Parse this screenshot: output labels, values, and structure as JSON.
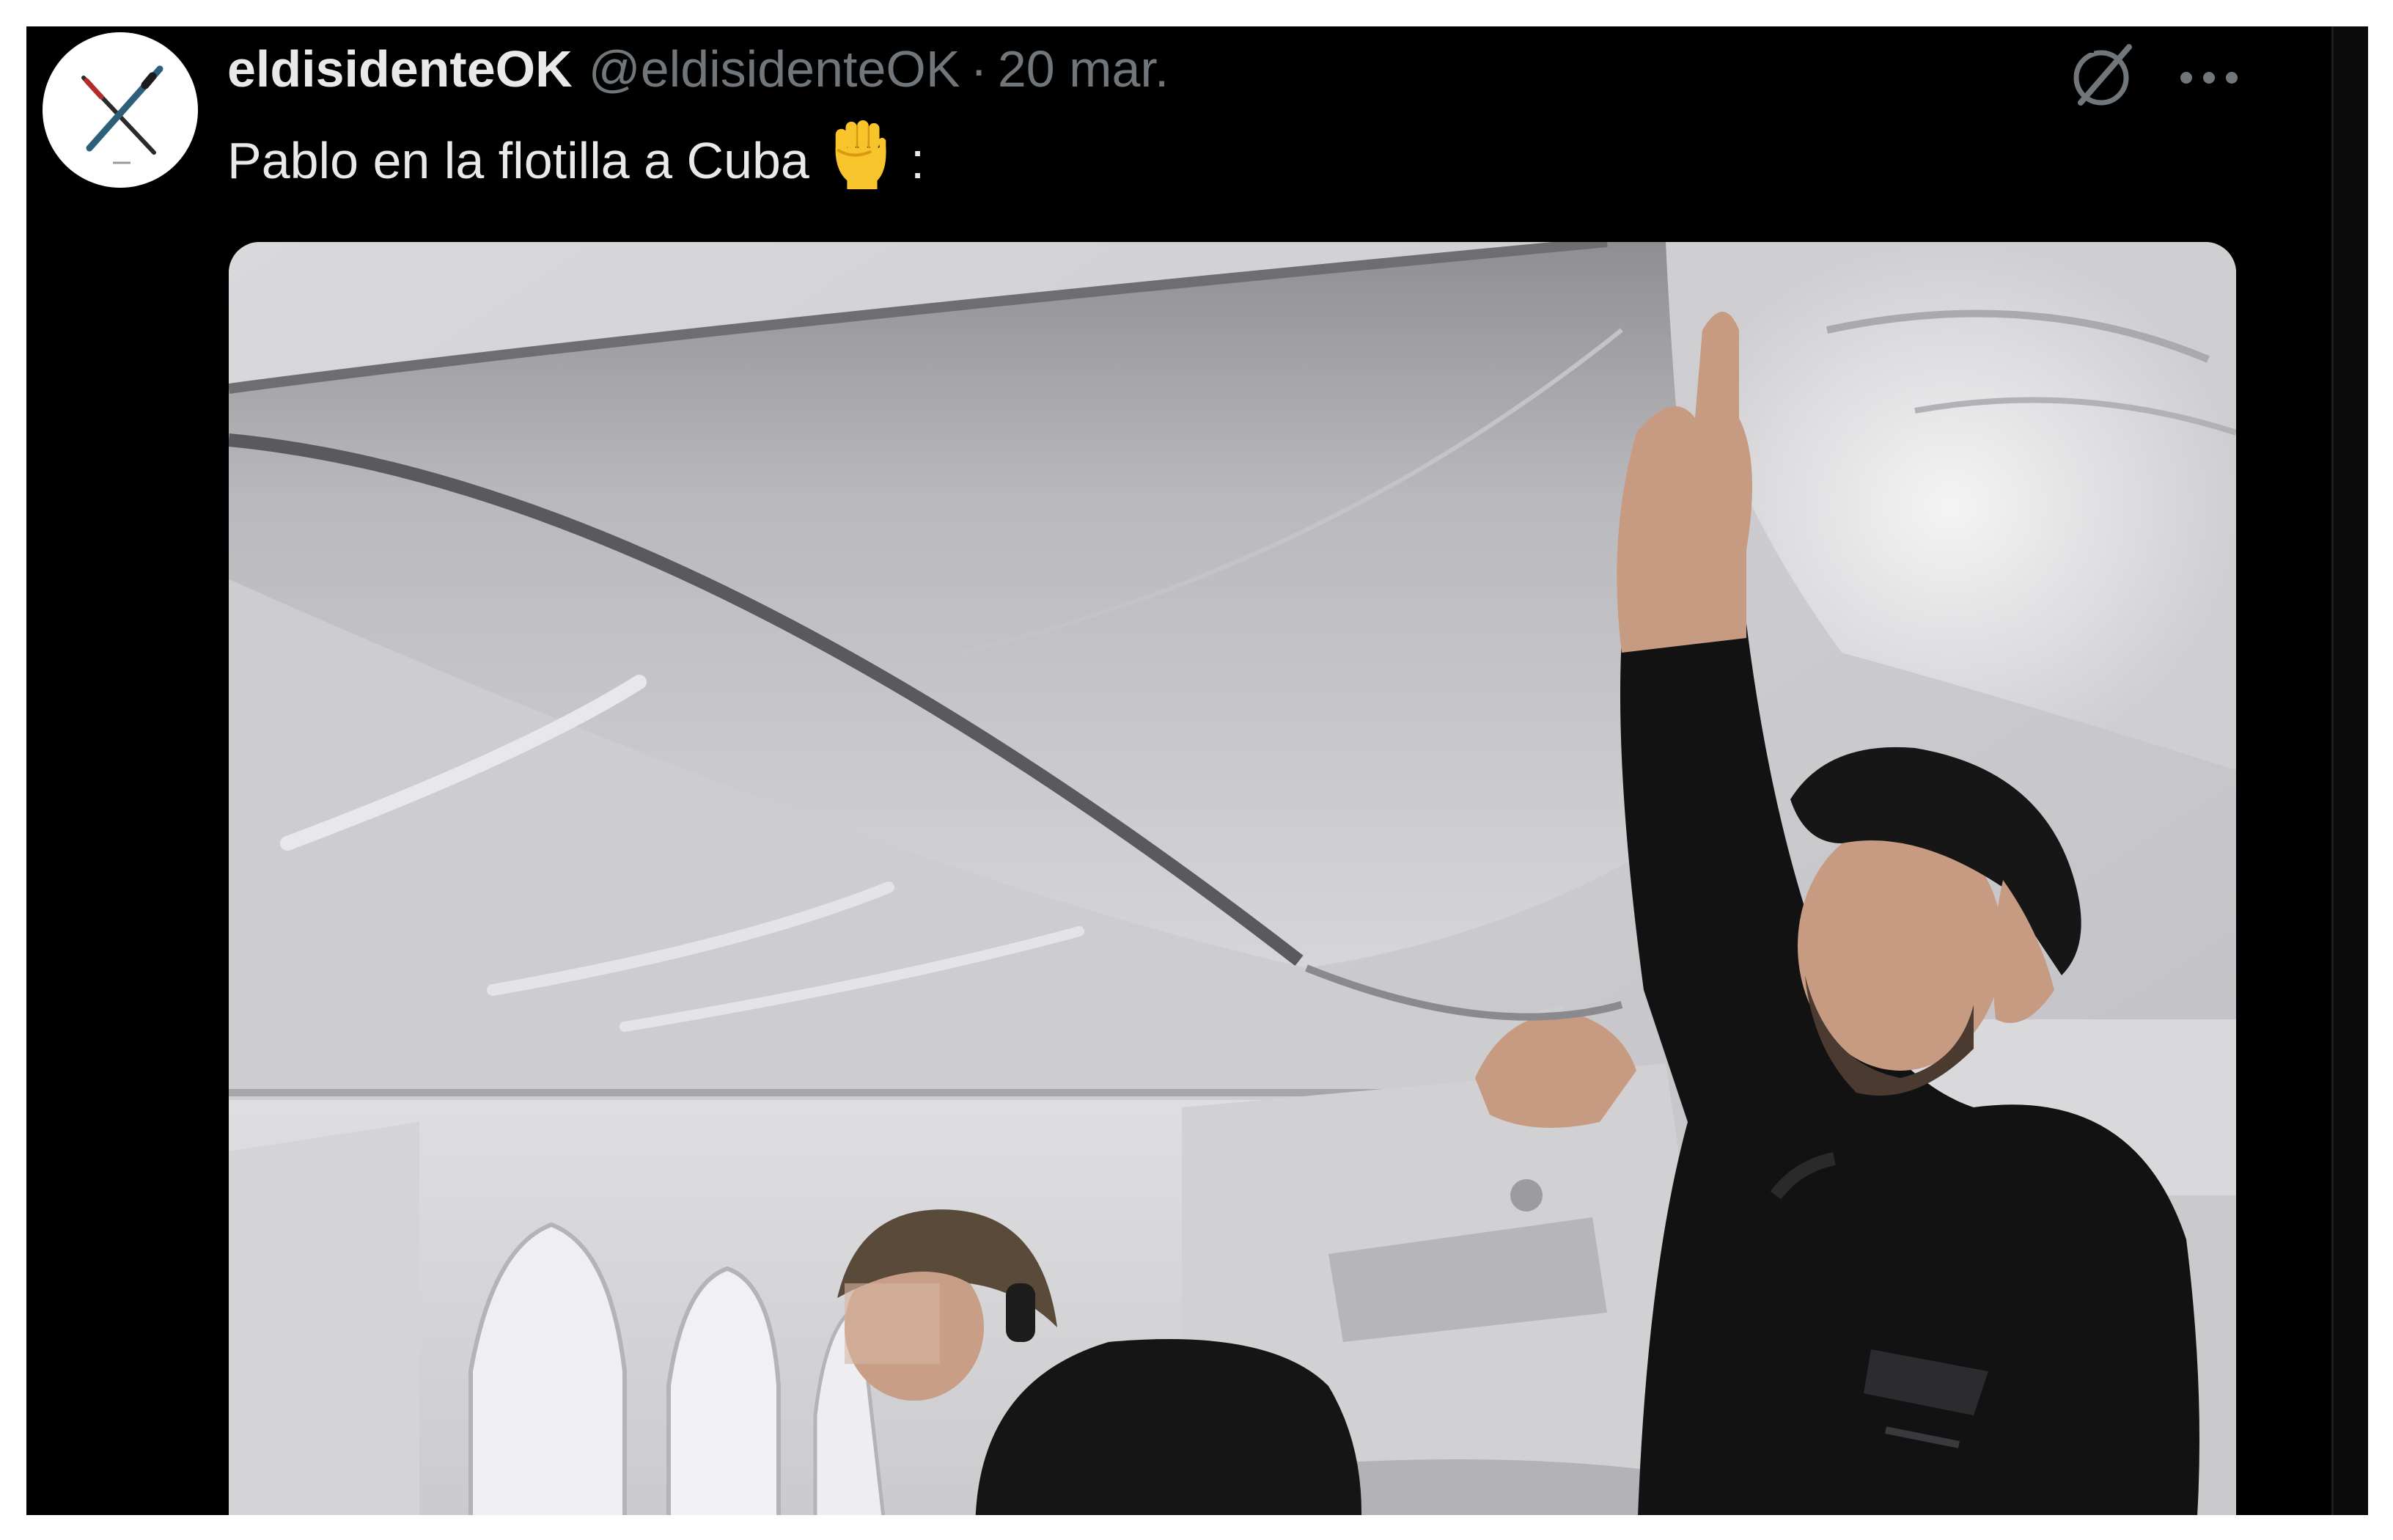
{
  "tweet": {
    "author": {
      "display_name": "eldisidenteOK",
      "handle": "@eldisidenteOK",
      "separator": "·",
      "date": "20 mar."
    },
    "text": "Pablo en la flotilla a Cuba",
    "text_suffix": ":",
    "emoji": "raised-fist",
    "media": {
      "type": "photo"
    }
  },
  "icons": {
    "grok": "grok-icon",
    "more": "more-options-icon",
    "avatar_logo": "crossed-pens-logo"
  },
  "colors": {
    "background": "#000000",
    "text_primary": "#e7e9ea",
    "text_secondary": "#71767b",
    "emoji_yellow": "#f7c52b"
  }
}
